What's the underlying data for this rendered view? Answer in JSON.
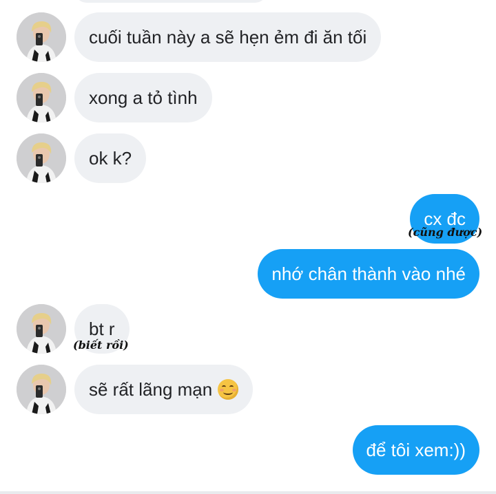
{
  "colors": {
    "incoming_bubble": "#eef0f3",
    "outgoing_bubble": "#16a0f5",
    "incoming_text": "#222326",
    "outgoing_text": "#ffffff"
  },
  "messages": [
    {
      "direction": "incoming",
      "text": "cuối tuần này a sẽ hẹn ẻm đi ăn tối",
      "avatar": "user-avatar-photo"
    },
    {
      "direction": "incoming",
      "text": "xong a tỏ tình",
      "avatar": "user-avatar-photo"
    },
    {
      "direction": "incoming",
      "text": "ok k?",
      "avatar": "user-avatar-photo"
    },
    {
      "direction": "outgoing",
      "text": "cx đc",
      "annotation": "(cũng được)"
    },
    {
      "direction": "outgoing",
      "text": "nhớ chân thành vào nhé"
    },
    {
      "direction": "incoming",
      "text": "bt r",
      "annotation": "(biết rồi)",
      "avatar": "user-avatar-photo"
    },
    {
      "direction": "incoming",
      "text": "sẽ rất lãng mạn",
      "emoji": "smiling-face-emoji",
      "avatar": "user-avatar-photo"
    },
    {
      "direction": "outgoing",
      "text": "để tôi xem:))"
    }
  ]
}
